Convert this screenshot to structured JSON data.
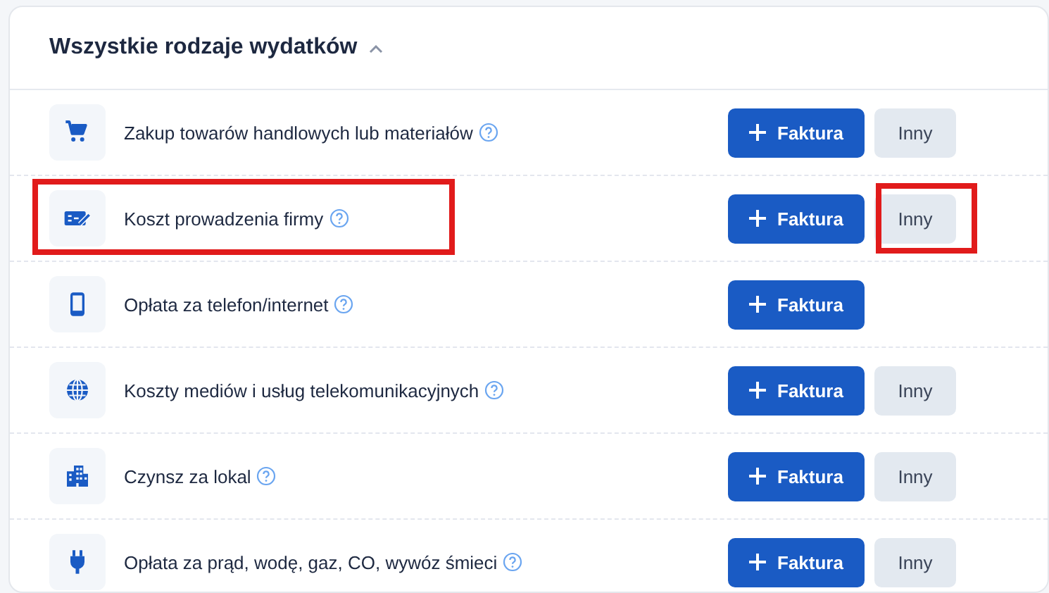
{
  "section": {
    "title": "Wszystkie rodzaje wydatków",
    "expanded": true
  },
  "rows": [
    {
      "label": "Zakup towarów handlowych lub materiałów",
      "invoice_button": "Faktura",
      "other_button": "Inny",
      "highlighted": false,
      "other_highlighted": false
    },
    {
      "label": "Koszt prowadzenia firmy",
      "invoice_button": "Faktura",
      "other_button": "Inny",
      "highlighted": true,
      "other_highlighted": true
    },
    {
      "label": "Opłata za telefon/internet",
      "invoice_button": "Faktura",
      "highlighted": false,
      "other_highlighted": false
    },
    {
      "label": "Koszty mediów i usług telekomunikacyjnych",
      "invoice_button": "Faktura",
      "other_button": "Inny",
      "highlighted": false,
      "other_highlighted": false
    },
    {
      "label": "Czynsz za lokal",
      "invoice_button": "Faktura",
      "other_button": "Inny",
      "highlighted": false,
      "other_highlighted": false
    },
    {
      "label": "Opłata za prąd, wodę, gaz, CO, wywóz śmieci",
      "invoice_button": "Faktura",
      "other_button": "Inny",
      "highlighted": false,
      "other_highlighted": false
    }
  ]
}
